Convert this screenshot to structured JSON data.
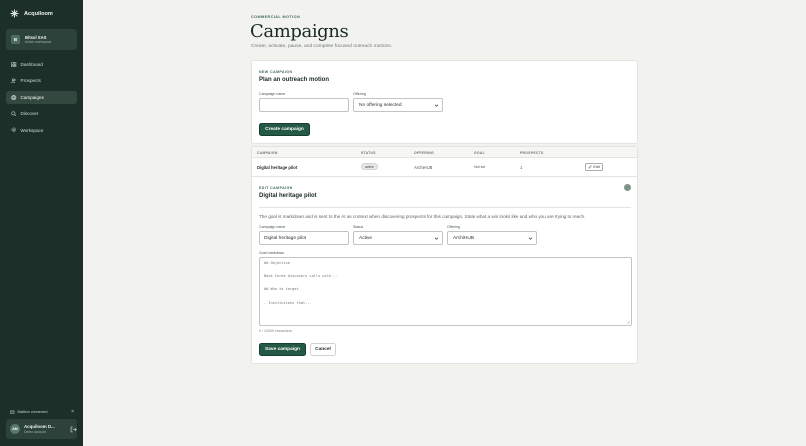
{
  "sidebar": {
    "brand": "Acquiloom",
    "org": {
      "initial": "B",
      "name": "Bitsol SAS",
      "sub": "Active workspace"
    },
    "nav": [
      {
        "label": "Dashboard",
        "icon": "grid-icon"
      },
      {
        "label": "Prospects",
        "icon": "users-icon"
      },
      {
        "label": "Campaigns",
        "icon": "target-icon",
        "active": true
      },
      {
        "label": "Discover",
        "icon": "search-icon"
      },
      {
        "label": "Workspace",
        "icon": "gear-icon"
      }
    ],
    "mailbox": {
      "label": "Mailbox connected",
      "close": "×"
    },
    "user": {
      "initials": "AM",
      "name": "Acquiloom D...",
      "sub": "Demo account"
    }
  },
  "header": {
    "eyebrow": "COMMERCIAL MOTION",
    "title": "Campaigns",
    "subtitle": "Create, activate, pause, and complete focused outreach motions."
  },
  "new_campaign": {
    "eyebrow": "NEW CAMPAIGN",
    "title": "Plan an outreach motion",
    "name_label": "Campaign name",
    "name_value": "",
    "offering_label": "Offering",
    "offering_value": "No offering selected",
    "create_button": "Create campaign"
  },
  "table": {
    "columns": [
      "CAMPAIGN",
      "STATUS",
      "OFFERING",
      "GOAL",
      "PROSPECTS"
    ],
    "rows": [
      {
        "campaign": "Digital heritage pilot",
        "status": "active",
        "offering": "ArchiHUB",
        "goal": "Not set",
        "prospects": "1",
        "action": "Edit"
      }
    ]
  },
  "edit_campaign": {
    "eyebrow": "EDIT CAMPAIGN",
    "title": "Digital heritage pilot",
    "hint": "The goal is markdown and is sent to the AI as context when discovering prospects for this campaign. State what a win looks like and who you are trying to reach.",
    "name_label": "Campaign name",
    "name_value": "Digital heritage pilot",
    "status_label": "Status",
    "status_value": "Active",
    "offering_label": "Offering",
    "offering_value": "ArchiHUB",
    "goal_label": "Goal markdown",
    "goal_placeholder_lines": [
      "## Objective",
      "Book three discovery calls with...",
      "## Who to target",
      "- Institutions that..."
    ],
    "char_count": "0 / 10000 characters",
    "save_button": "Save campaign",
    "cancel_button": "Cancel"
  },
  "colors": {
    "sidebar": "#1c3029",
    "accent": "#245a45",
    "background": "#f2f3ee"
  }
}
